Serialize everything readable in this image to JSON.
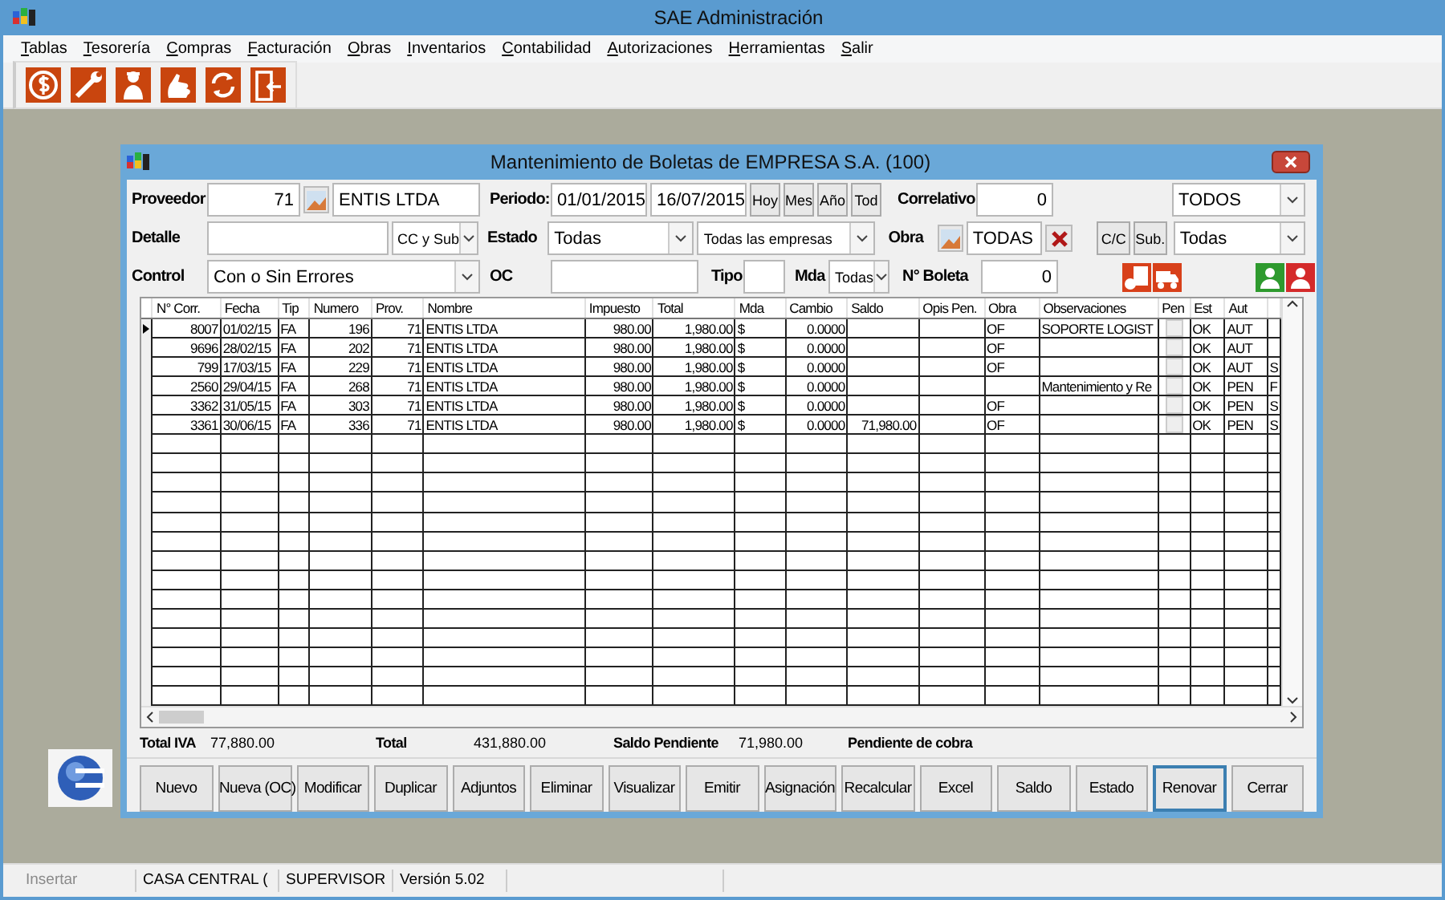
{
  "window": {
    "title": "SAE Administración"
  },
  "menu": [
    "Tablas",
    "Tesorería",
    "Compras",
    "Facturación",
    "Obras",
    "Inventarios",
    "Contabilidad",
    "Autorizaciones",
    "Herramientas",
    "Salir"
  ],
  "dialog": {
    "title": "Mantenimiento de Boletas de EMPRESA S.A. (100)",
    "proveedor": {
      "label": "Proveedor",
      "code": "71",
      "name": "ENTIS LTDA"
    },
    "periodo": {
      "label": "Periodo:",
      "from": "01/01/2015",
      "to": "16/07/2015",
      "buttons": [
        "Hoy",
        "Mes",
        "Año",
        "Tod"
      ]
    },
    "correlativo": {
      "label": "Correlativo",
      "value": "0"
    },
    "right_combo_1": {
      "value": "TODOS"
    },
    "detalle": {
      "label": "Detalle",
      "combo": "CC y Sub"
    },
    "estado": {
      "label": "Estado",
      "value": "Todas",
      "empresas": "Todas las empresas"
    },
    "obra": {
      "label": "Obra",
      "value": "TODAS"
    },
    "cc_buttons": [
      "C/C",
      "Sub."
    ],
    "right_combo_2": {
      "value": "Todas"
    },
    "control": {
      "label": "Control",
      "value": "Con o Sin Errores"
    },
    "oc": {
      "label": "OC"
    },
    "tipo": {
      "label": "Tipo"
    },
    "mda": {
      "label": "Mda",
      "value": "Todas"
    },
    "boleta": {
      "label": "N° Boleta",
      "value": "0"
    },
    "table": {
      "columns": [
        "N° Corr.",
        "Fecha",
        "Tip",
        "Numero",
        "Prov.",
        "Nombre",
        "Impuesto",
        "Total",
        "Mda",
        "Cambio",
        "Saldo",
        "Opis Pen.",
        "Obra",
        "Observaciones",
        "Pen",
        "Est",
        "Aut"
      ],
      "rows": [
        {
          "selected": true,
          "corr": "8007",
          "fecha": "01/02/15",
          "tip": "FA",
          "numero": "196",
          "prov": "71",
          "nombre": "ENTIS LTDA",
          "impuesto": "980.00",
          "total": "1,980.00",
          "mda": "$",
          "cambio": "0.0000",
          "obra": "OF",
          "observaciones": "SOPORTE LOGIST",
          "pen": false,
          "est": "OK",
          "aut": "AUT"
        },
        {
          "selected": false,
          "corr": "9696",
          "fecha": "28/02/15",
          "tip": "FA",
          "numero": "202",
          "prov": "71",
          "nombre": "ENTIS LTDA",
          "impuesto": "980.00",
          "total": "1,980.00",
          "mda": "$",
          "cambio": "0.0000",
          "obra": "OF",
          "pen": false,
          "est": "OK",
          "aut": "AUT"
        },
        {
          "selected": false,
          "corr": "799",
          "fecha": "17/03/15",
          "tip": "FA",
          "numero": "229",
          "prov": "71",
          "nombre": "ENTIS LTDA",
          "impuesto": "980.00",
          "total": "1,980.00",
          "mda": "$",
          "cambio": "0.0000",
          "obra": "OF",
          "pen": false,
          "est": "OK",
          "aut": "AUT",
          "column_18": "S"
        },
        {
          "selected": false,
          "corr": "2560",
          "fecha": "29/04/15",
          "tip": "FA",
          "numero": "268",
          "prov": "71",
          "nombre": "ENTIS LTDA",
          "impuesto": "980.00",
          "total": "1,980.00",
          "mda": "$",
          "cambio": "0.0000",
          "observaciones": "Mantenimiento y Re",
          "pen": false,
          "est": "OK",
          "aut": "PEN",
          "column_18": "F"
        },
        {
          "selected": false,
          "corr": "3362",
          "fecha": "31/05/15",
          "tip": "FA",
          "numero": "303",
          "prov": "71",
          "nombre": "ENTIS LTDA",
          "impuesto": "980.00",
          "total": "1,980.00",
          "mda": "$",
          "cambio": "0.0000",
          "obra": "OF",
          "pen": false,
          "est": "OK",
          "aut": "PEN",
          "column_18": "S"
        },
        {
          "selected": false,
          "corr": "3361",
          "fecha": "30/06/15",
          "tip": "FA",
          "numero": "336",
          "prov": "71",
          "nombre": "ENTIS LTDA",
          "impuesto": "980.00",
          "total": "1,980.00",
          "mda": "$",
          "cambio": "0.0000",
          "saldo": "71,980.00",
          "obra": "OF",
          "pen": false,
          "est": "OK",
          "aut": "PEN",
          "column_18": "S"
        }
      ]
    },
    "totals": [
      {
        "label": "Total IVA",
        "value": "77,880.00"
      },
      {
        "label": "Total",
        "value": "431,880.00"
      },
      {
        "label": "Saldo Pendiente",
        "value": "71,980.00"
      },
      {
        "label": "Pendiente de cobra"
      }
    ],
    "buttons": [
      {
        "label": "Nuevo",
        "focused": false
      },
      {
        "label": "Nueva (OC)",
        "focused": false
      },
      {
        "label": "Modificar",
        "focused": false
      },
      {
        "label": "Duplicar",
        "focused": false
      },
      {
        "label": "Adjuntos",
        "focused": false
      },
      {
        "label": "Eliminar",
        "focused": false
      },
      {
        "label": "Visualizar",
        "focused": false
      },
      {
        "label": "Emitir",
        "focused": false
      },
      {
        "label": "Asignación",
        "focused": false
      },
      {
        "label": "Recalcular",
        "focused": false
      },
      {
        "label": "Excel",
        "focused": false
      },
      {
        "label": "Saldo",
        "focused": false
      },
      {
        "label": "Estado",
        "focused": false
      },
      {
        "label": "Renovar",
        "focused": true
      },
      {
        "label": "Cerrar",
        "focused": false
      }
    ]
  },
  "status_bar": [
    {
      "text": "Insertar",
      "disabled": true
    },
    {
      "text": "CASA CENTRAL (",
      "disabled": false
    },
    {
      "text": "SUPERVISOR",
      "disabled": false
    },
    {
      "text": "Versión 5.02",
      "disabled": false
    }
  ]
}
